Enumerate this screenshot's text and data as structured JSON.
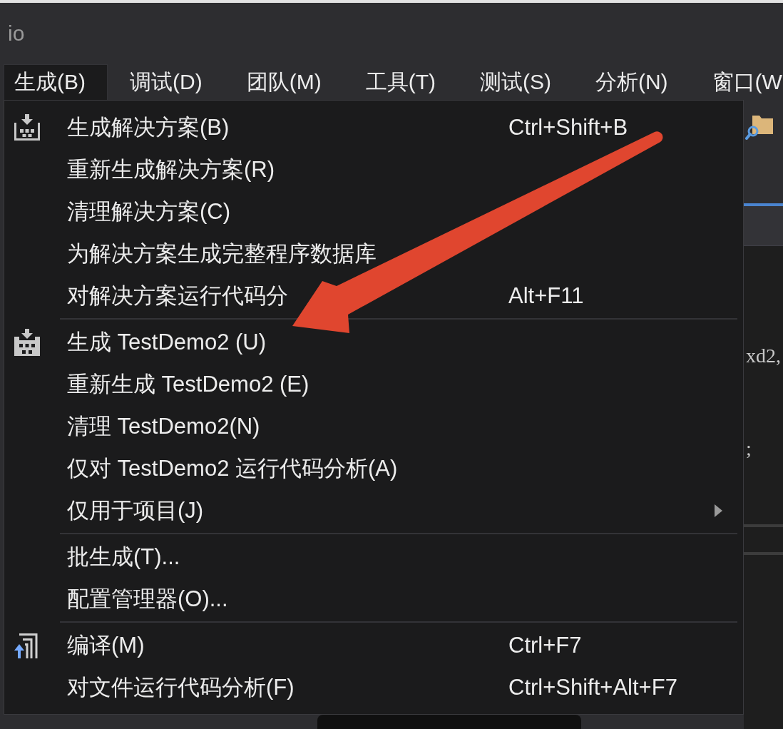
{
  "window": {
    "title": "io"
  },
  "menu_bar": [
    {
      "label": "生成(B)",
      "selected": true
    },
    {
      "label": "调试(D)",
      "selected": false
    },
    {
      "label": "团队(M)",
      "selected": false
    },
    {
      "label": "工具(T)",
      "selected": false
    },
    {
      "label": "测试(S)",
      "selected": false
    },
    {
      "label": "分析(N)",
      "selected": false
    },
    {
      "label": "窗口(W",
      "selected": false
    }
  ],
  "menu": {
    "groups": [
      [
        {
          "kind": "solution",
          "label": "生成解决方案(B)",
          "shortcut": "Ctrl+Shift+B"
        },
        {
          "kind": "plain",
          "label": "重新生成解决方案(R)"
        },
        {
          "kind": "plain",
          "label": "清理解决方案(C)"
        },
        {
          "kind": "plain",
          "label": "为解决方案生成完整程序数据库"
        },
        {
          "kind": "plain",
          "label": "对解决方案运行代码分",
          "shortcut": "Alt+F11"
        }
      ],
      [
        {
          "kind": "project",
          "label": "生成 TestDemo2 (U)"
        },
        {
          "kind": "plain",
          "label": "重新生成 TestDemo2 (E)"
        },
        {
          "kind": "plain",
          "label": "清理 TestDemo2(N)"
        },
        {
          "kind": "plain",
          "label": "仅对 TestDemo2 运行代码分析(A)"
        },
        {
          "kind": "submenu",
          "label": "仅用于项目(J)"
        }
      ],
      [
        {
          "kind": "plain",
          "label": "批生成(T)..."
        },
        {
          "kind": "plain",
          "label": "配置管理器(O)..."
        }
      ],
      [
        {
          "kind": "compile",
          "label": "编译(M)",
          "shortcut": "Ctrl+F7"
        },
        {
          "kind": "plain",
          "label": "对文件运行代码分析(F)",
          "shortcut": "Ctrl+Shift+Alt+F7"
        }
      ]
    ]
  },
  "editor": {
    "code_fragments": [
      "xd2,",
      ";"
    ]
  }
}
